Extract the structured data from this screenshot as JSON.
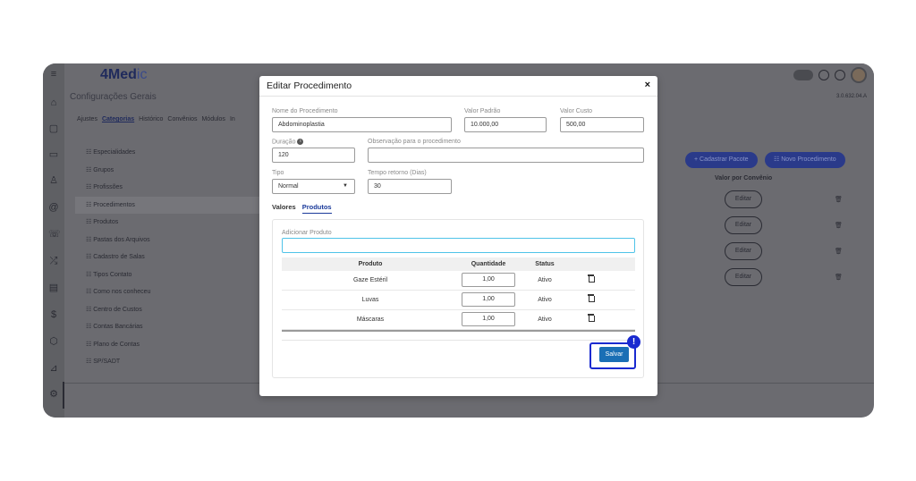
{
  "app": {
    "logo_main": "4Med",
    "logo_tail": "ic",
    "page_title": "Configurações Gerais",
    "version": "3.0.632.04.A"
  },
  "nav_tabs": [
    {
      "label": "Ajustes",
      "active": false
    },
    {
      "label": "Categorias",
      "active": true
    },
    {
      "label": "Histórico",
      "active": false
    },
    {
      "label": "Convênios",
      "active": false
    },
    {
      "label": "Módulos",
      "active": false
    },
    {
      "label": "In",
      "active": false
    }
  ],
  "categories": [
    {
      "label": "☷ Especialidades"
    },
    {
      "label": "☷ Grupos"
    },
    {
      "label": "☷ Profissões"
    },
    {
      "label": "☷ Procedimentos",
      "selected": true
    },
    {
      "label": "☷ Produtos"
    },
    {
      "label": "☷ Pastas dos Arquivos"
    },
    {
      "label": "☷ Cadastro de Salas"
    },
    {
      "label": "☷ Tipos Contato"
    },
    {
      "label": "☷ Como nos conheceu"
    },
    {
      "label": "☷ Centro de Custos"
    },
    {
      "label": "☷ Contas Bancárias"
    },
    {
      "label": "☷ Plano de Contas"
    },
    {
      "label": "☷ SP/SADT"
    }
  ],
  "right_panel": {
    "cadastrar_pacote": "+ Cadastrar Pacote",
    "novo_procedimento": "☷ Novo Procedimento",
    "valor_header": "Valor por Convênio",
    "editar_label": "Editar"
  },
  "modal": {
    "title": "Editar Procedimento",
    "close": "×",
    "fields": {
      "nome_label": "Nome do Procedimento",
      "nome_value": "Abdominoplastia",
      "valor_padrao_label": "Valor Padrão",
      "valor_padrao_value": "10.000,00",
      "valor_custo_label": "Valor Custo",
      "valor_custo_value": "500,00",
      "duracao_label": "Duração",
      "duracao_value": "120",
      "observacao_label": "Observação para o procedimento",
      "observacao_value": "",
      "tipo_label": "Tipo",
      "tipo_value": "Normal",
      "tempo_retorno_label": "Tempo retorno (Dias)",
      "tempo_retorno_value": "30"
    },
    "sub_tabs": [
      {
        "label": "Valores",
        "active": false
      },
      {
        "label": "Produtos",
        "active": true
      }
    ],
    "produtos": {
      "add_label": "Adicionar Produto",
      "add_value": "",
      "columns": [
        "Produto",
        "Quantidade",
        "Status"
      ],
      "rows": [
        {
          "produto": "Gaze Estéril",
          "quantidade": "1,00",
          "status": "Ativo"
        },
        {
          "produto": "Luvas",
          "quantidade": "1,00",
          "status": "Ativo"
        },
        {
          "produto": "Máscaras",
          "quantidade": "1,00",
          "status": "Ativo"
        }
      ]
    },
    "save_label": "Salvar",
    "alert_badge": "!"
  },
  "colors": {
    "primary": "#1a6fb5",
    "highlight": "#1a2ad0",
    "overlay": "#6b6b70"
  }
}
